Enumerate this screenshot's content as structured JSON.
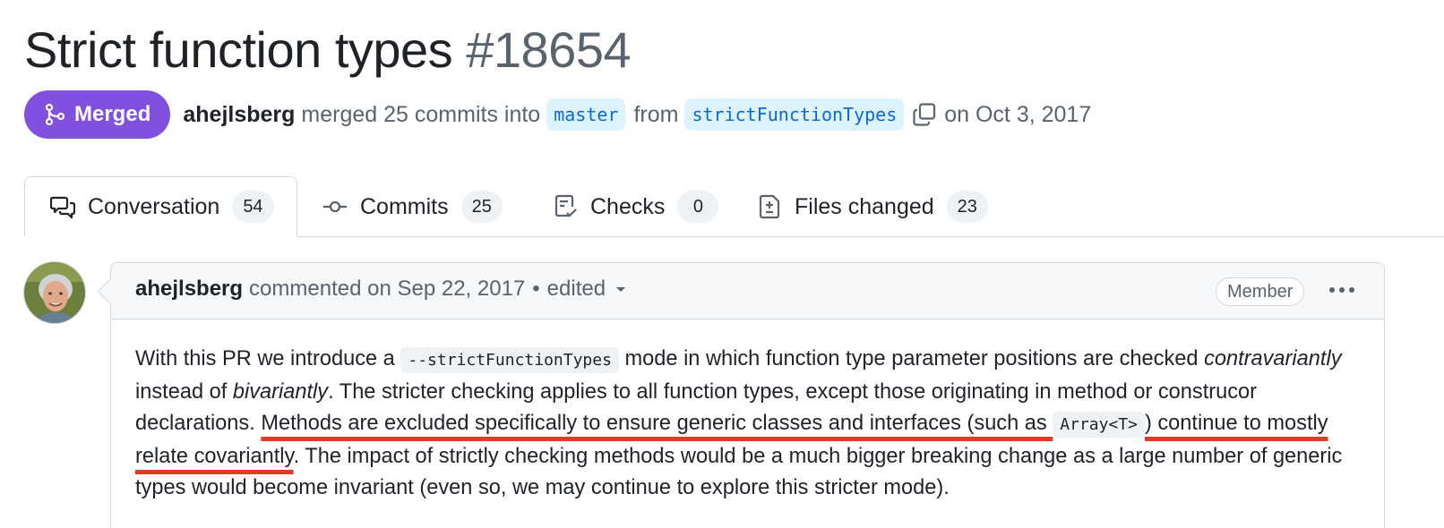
{
  "pr": {
    "title": "Strict function types",
    "number": "#18654",
    "state": "Merged",
    "author": "ahejlsberg",
    "merged_text": "merged 25 commits into",
    "base_branch": "master",
    "from_text": "from",
    "head_branch": "strictFunctionTypes",
    "date_text": "on Oct 3, 2017"
  },
  "tabs": [
    {
      "label": "Conversation",
      "count": "54",
      "icon": "comment-discussion-icon",
      "active": true
    },
    {
      "label": "Commits",
      "count": "25",
      "icon": "git-commit-icon",
      "active": false
    },
    {
      "label": "Checks",
      "count": "0",
      "icon": "checklist-icon",
      "active": false
    },
    {
      "label": "Files changed",
      "count": "23",
      "icon": "file-diff-icon",
      "active": false
    }
  ],
  "comment": {
    "author": "ahejlsberg",
    "action": "commented on Sep 22, 2017",
    "separator": "•",
    "edited": "edited",
    "role": "Member",
    "body": {
      "s1": "With this PR we introduce a ",
      "code1": "--strictFunctionTypes",
      "s2": " mode in which function type parameter positions are checked ",
      "em1": "contravariantly",
      "s3": " instead of ",
      "em2": "bivariantly",
      "s4": ". The stricter checking applies to all function types, except those originating in method or construcor declarations. ",
      "hl1": "Methods are excluded specifically to ensure generic classes and interfaces (such as ",
      "code2": "Array<T>",
      "hl2": ") continue to mostly relate covariantly",
      "s5": ". The impact of strictly checking methods would be a much bigger breaking change as a large number of generic types would become invariant (even so, we may continue to explore this stricter mode)."
    }
  },
  "colors": {
    "merged": "#8250df",
    "branch_text": "#0969da",
    "branch_bg": "#ddf4ff",
    "highlight_underline": "#e03c24"
  }
}
